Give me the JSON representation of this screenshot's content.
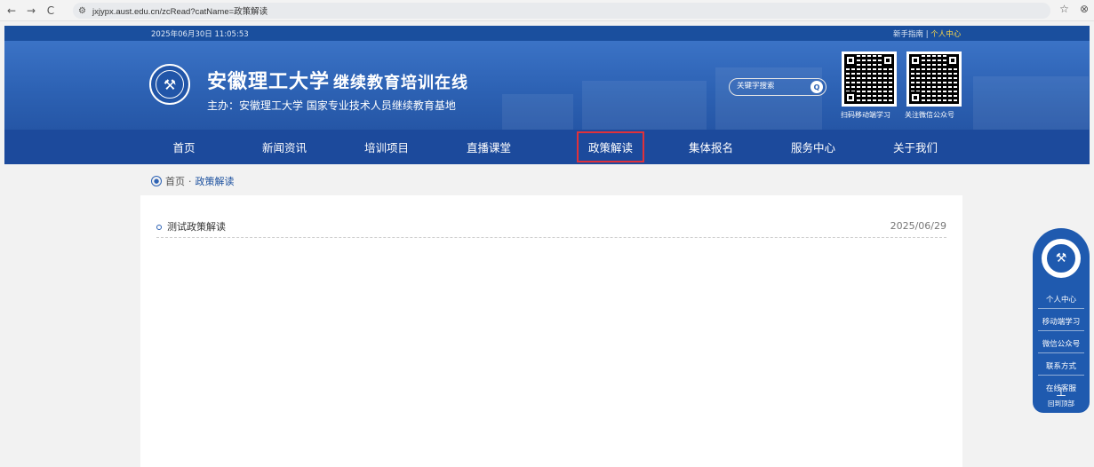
{
  "browser": {
    "url": "jxjypx.aust.edu.cn/zcRead?catName=政策解读",
    "back": "←",
    "forward": "→",
    "reload": "C",
    "star": "☆",
    "profile": "⊗"
  },
  "topbar": {
    "datetime": "2025年06月30日 11:05:53",
    "guide": "新手指南",
    "separator": " | ",
    "user_center": "个人中心"
  },
  "header": {
    "title": "安徽理工大学",
    "title_sub": "继续教育培训在线",
    "subtitle": "主办：安徽理工大学   国家专业技术人员继续教育基地",
    "search_placeholder": "关键字搜索",
    "qr_labels": [
      "扫码移动端学习",
      "关注微信公众号"
    ],
    "colors": {
      "primary": "#2d62b4",
      "nav": "#1c4a9c",
      "highlight": "#f7d54a",
      "active_border": "#e0313a"
    }
  },
  "nav": {
    "items": [
      "首页",
      "新闻资讯",
      "培训项目",
      "直播课堂",
      "政策解读",
      "集体报名",
      "服务中心",
      "关于我们"
    ],
    "active_index": 4
  },
  "breadcrumb": {
    "home": "首页",
    "separator": " · ",
    "current": "政策解读"
  },
  "list": {
    "items": [
      {
        "title": "测试政策解读",
        "date": "2025/06/29"
      }
    ]
  },
  "side_bar": {
    "items": [
      "个人中心",
      "移动端学习",
      "微信公众号",
      "联系方式",
      "在线客服"
    ],
    "back_to_top": "回到顶部"
  }
}
